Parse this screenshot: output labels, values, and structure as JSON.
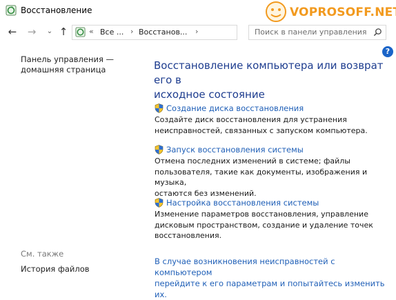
{
  "window": {
    "title": "Восстановление"
  },
  "watermark": {
    "text": "VOPROSOFF.NET"
  },
  "nav": {
    "back": "←",
    "forward": "→",
    "recent": "⌄",
    "up": "↑",
    "address_prefix": "«",
    "crumb1": "Все ...",
    "sep1": "›",
    "crumb2": "Восстанов...",
    "sep2": "›",
    "dropdown": "⌄",
    "refresh": "↻",
    "search_placeholder": "Поиск в панели управления"
  },
  "help": {
    "label": "?"
  },
  "sidebar": {
    "home_link_line1": "Панель управления —",
    "home_link_line2": "домашняя страница",
    "see_also": "См. также",
    "file_history": "История файлов"
  },
  "main": {
    "title_line1": "Восстановление компьютера или возврат его в",
    "title_line2": "исходное состояние",
    "items": [
      {
        "link": "Создание диска восстановления",
        "desc_line1": "Создайте диск восстановления для устранения",
        "desc_line2": "неисправностей, связанных с запуском компьютера."
      },
      {
        "link": "Запуск восстановления системы",
        "desc_line1": "Отмена последних изменений в системе; файлы",
        "desc_line2": "пользователя, такие как документы, изображения и музыка,",
        "desc_line3": "остаются без изменений."
      },
      {
        "link": "Настройка восстановления системы",
        "desc_line1": "Изменение параметров восстановления, управление",
        "desc_line2": "дисковым пространством, создание и удаление точек",
        "desc_line3": "восстановления."
      }
    ],
    "bottom_line1": "В случае возникновения неисправностей с компьютером",
    "bottom_line2": "перейдите к его параметрам и попытайтесь изменить их."
  },
  "colors": {
    "accent_title": "#1e3d8f",
    "link": "#1f5fb7",
    "watermark": "#f29a1f"
  },
  "icons": {
    "app": "recovery-icon",
    "shield": "uac-shield-icon",
    "search": "search-icon"
  }
}
